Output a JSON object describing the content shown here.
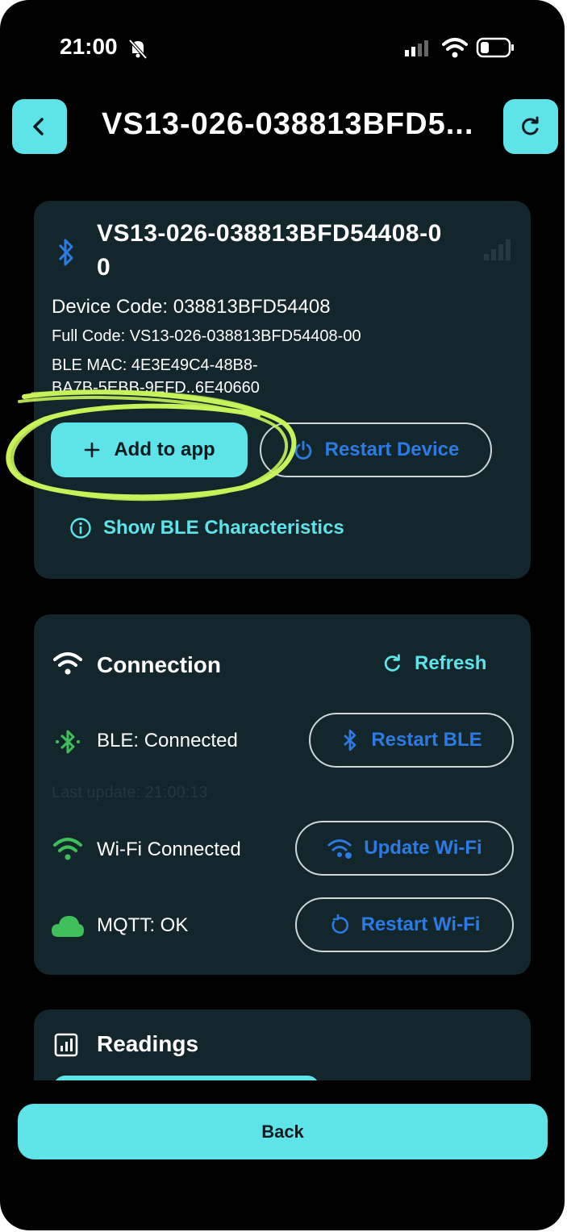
{
  "status_bar": {
    "time": "21:00"
  },
  "header": {
    "title": "VS13-026-038813BFD5..."
  },
  "device_card": {
    "name_line1": "VS13-026-038813BFD54408-0",
    "name_line2": "0",
    "device_code": "Device Code: 038813BFD54408",
    "full_code": "Full Code: VS13-026-038813BFD54408-00",
    "ble_mac_line1": "BLE MAC: 4E3E49C4-48B8-",
    "ble_mac_line2": "BA7B-5EBB-9EFD..6E40660",
    "add_button": "Add to app",
    "restart_button": "Restart Device",
    "show_ble": "Show BLE Characteristics"
  },
  "connection_card": {
    "title": "Connection",
    "refresh": "Refresh",
    "ble_status": "BLE: Connected",
    "restart_ble": "Restart BLE",
    "last_update": "Last update: 21:00:13",
    "wifi_status": "Wi-Fi Connected",
    "update_wifi": "Update Wi-Fi",
    "mqtt_status": "MQTT: OK",
    "restart_wifi": "Restart Wi-Fi"
  },
  "readings_card": {
    "title": "Readings"
  },
  "footer": {
    "back": "Back"
  },
  "colors": {
    "accent": "#5ee3e9",
    "card": "#12262b",
    "blue": "#2c7be5",
    "green": "#3fbf5a",
    "highlight": "#c8f25a"
  }
}
